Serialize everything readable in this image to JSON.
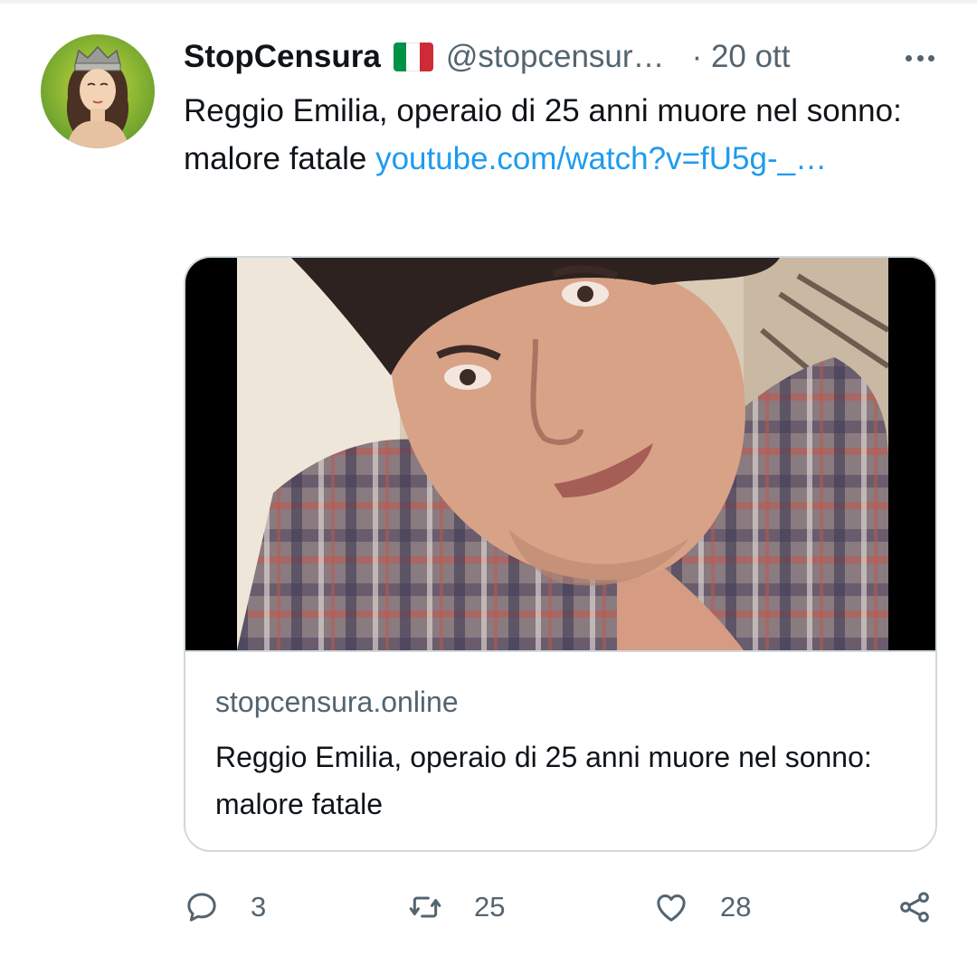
{
  "tweet": {
    "author": {
      "display_name": "StopCensura",
      "flag": "italy-flag-icon",
      "handle": "@stopcensur…",
      "time": "· 20 ott"
    },
    "more_icon": "more-horizontal-icon",
    "text": "Reggio Emilia, operaio di 25 anni muore nel sonno: malore fatale",
    "link": "youtube.com/watch?v=fU5g-_…",
    "card": {
      "domain": "stopcensura.online",
      "title": "Reggio Emilia, operaio di 25 anni muore nel sonno: malore fatale"
    },
    "actions": {
      "reply": {
        "icon": "reply-bubble-icon",
        "count": "3"
      },
      "retweet": {
        "icon": "retweet-icon",
        "count": "25"
      },
      "like": {
        "icon": "heart-icon",
        "count": "28"
      },
      "share": {
        "icon": "share-icon"
      }
    }
  },
  "colors": {
    "text_primary": "#0f1419",
    "text_secondary": "#536471",
    "link": "#1d9bf0",
    "border": "#cfd9de",
    "flag_green": "#009246",
    "flag_white": "#ffffff",
    "flag_red": "#ce2b37"
  }
}
